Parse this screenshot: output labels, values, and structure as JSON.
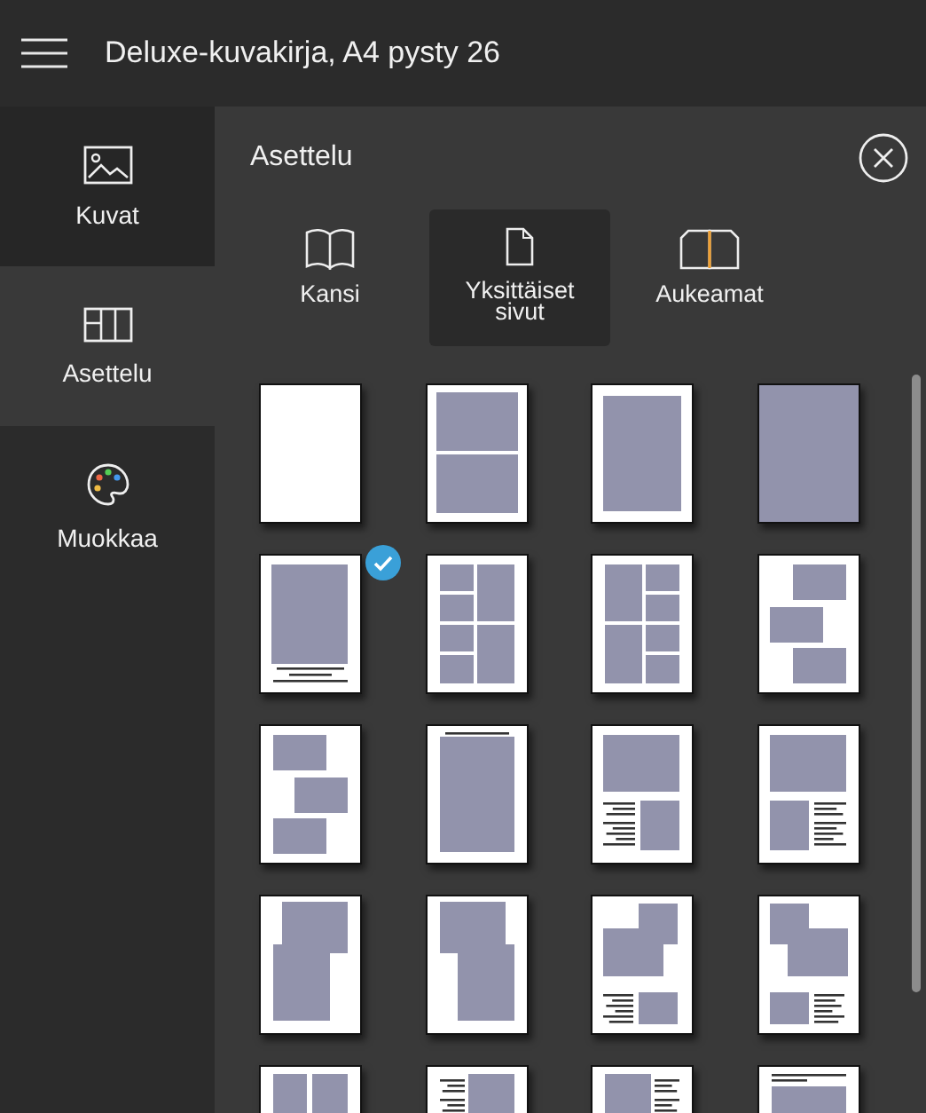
{
  "window": {
    "title": "Deluxe-kuvakirja, A4 pysty 26"
  },
  "sidebar": {
    "items": [
      {
        "label": "Kuvat",
        "kind": "pictures",
        "selected": false
      },
      {
        "label": "Asettelu",
        "kind": "layout",
        "selected": true
      },
      {
        "label": "Muokkaa",
        "kind": "palette",
        "selected": false
      }
    ]
  },
  "panel": {
    "title": "Asettelu",
    "tabs": [
      {
        "label": "Kansi",
        "kind": "cover",
        "selected": false
      },
      {
        "label": "Yksittäiset sivut",
        "kind": "page",
        "selected": true
      },
      {
        "label": "Aukeamat",
        "kind": "spread",
        "selected": false
      }
    ],
    "layouts": [
      {
        "kind": "blank",
        "selected": false
      },
      {
        "kind": "two-stack",
        "selected": false
      },
      {
        "kind": "single",
        "selected": false
      },
      {
        "kind": "full",
        "selected": false
      },
      {
        "kind": "caption",
        "selected": true
      },
      {
        "kind": "grid-left",
        "selected": false
      },
      {
        "kind": "grid-right",
        "selected": false
      },
      {
        "kind": "zigzag-right",
        "selected": false
      },
      {
        "kind": "zigzag-left",
        "selected": false
      },
      {
        "kind": "title-photo",
        "selected": false
      },
      {
        "kind": "text-left",
        "selected": false
      },
      {
        "kind": "text-right",
        "selected": false
      },
      {
        "kind": "overlap-left",
        "selected": false
      },
      {
        "kind": "overlap-right",
        "selected": false
      },
      {
        "kind": "collage-text-left",
        "selected": false
      },
      {
        "kind": "collage-text-right",
        "selected": false
      },
      {
        "kind": "two-column",
        "selected": false
      },
      {
        "kind": "column-text-left",
        "selected": false
      },
      {
        "kind": "column-text-right",
        "selected": false
      },
      {
        "kind": "header-photo",
        "selected": false
      }
    ]
  }
}
